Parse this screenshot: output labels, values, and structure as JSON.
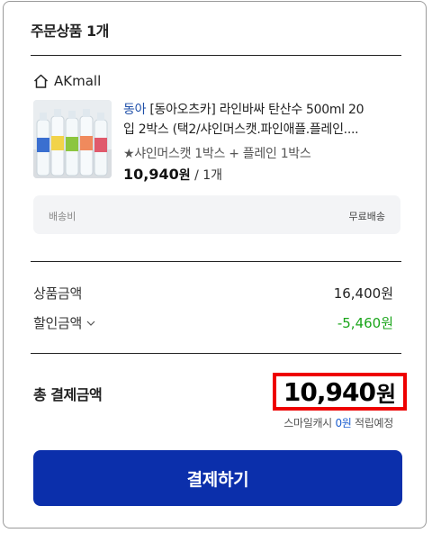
{
  "order": {
    "section_title": "주문상품 1개",
    "store_name": "AKmall",
    "product": {
      "brand": "동아",
      "title_line1_rest": " [동아오츠카] 라인바싸 탄산수 500ml 20",
      "title_line2": "입 2박스 (택2/샤인머스캣.파인애플.플레인....",
      "option": "★샤인머스캣 1박스 + 플레인 1박스",
      "price": "10,940",
      "price_unit": "원",
      "quantity": " / 1개"
    },
    "shipping": {
      "label": "배송비",
      "value": "무료배송"
    }
  },
  "summary": {
    "product_amount_label": "상품금액",
    "product_amount_value": "16,400원",
    "discount_label": "할인금액",
    "discount_value": "-5,460원"
  },
  "total": {
    "label": "총 결제금액",
    "amount": "10,940",
    "unit": "원",
    "smile_prefix": "스마일캐시 ",
    "smile_points": "0원",
    "smile_suffix": " 적립예정"
  },
  "pay_button_label": "결제하기",
  "colors": {
    "accent": "#0b2fab",
    "discount": "#1aa51a",
    "highlight_border": "#ee0000",
    "brand_link": "#1d4ea8"
  }
}
